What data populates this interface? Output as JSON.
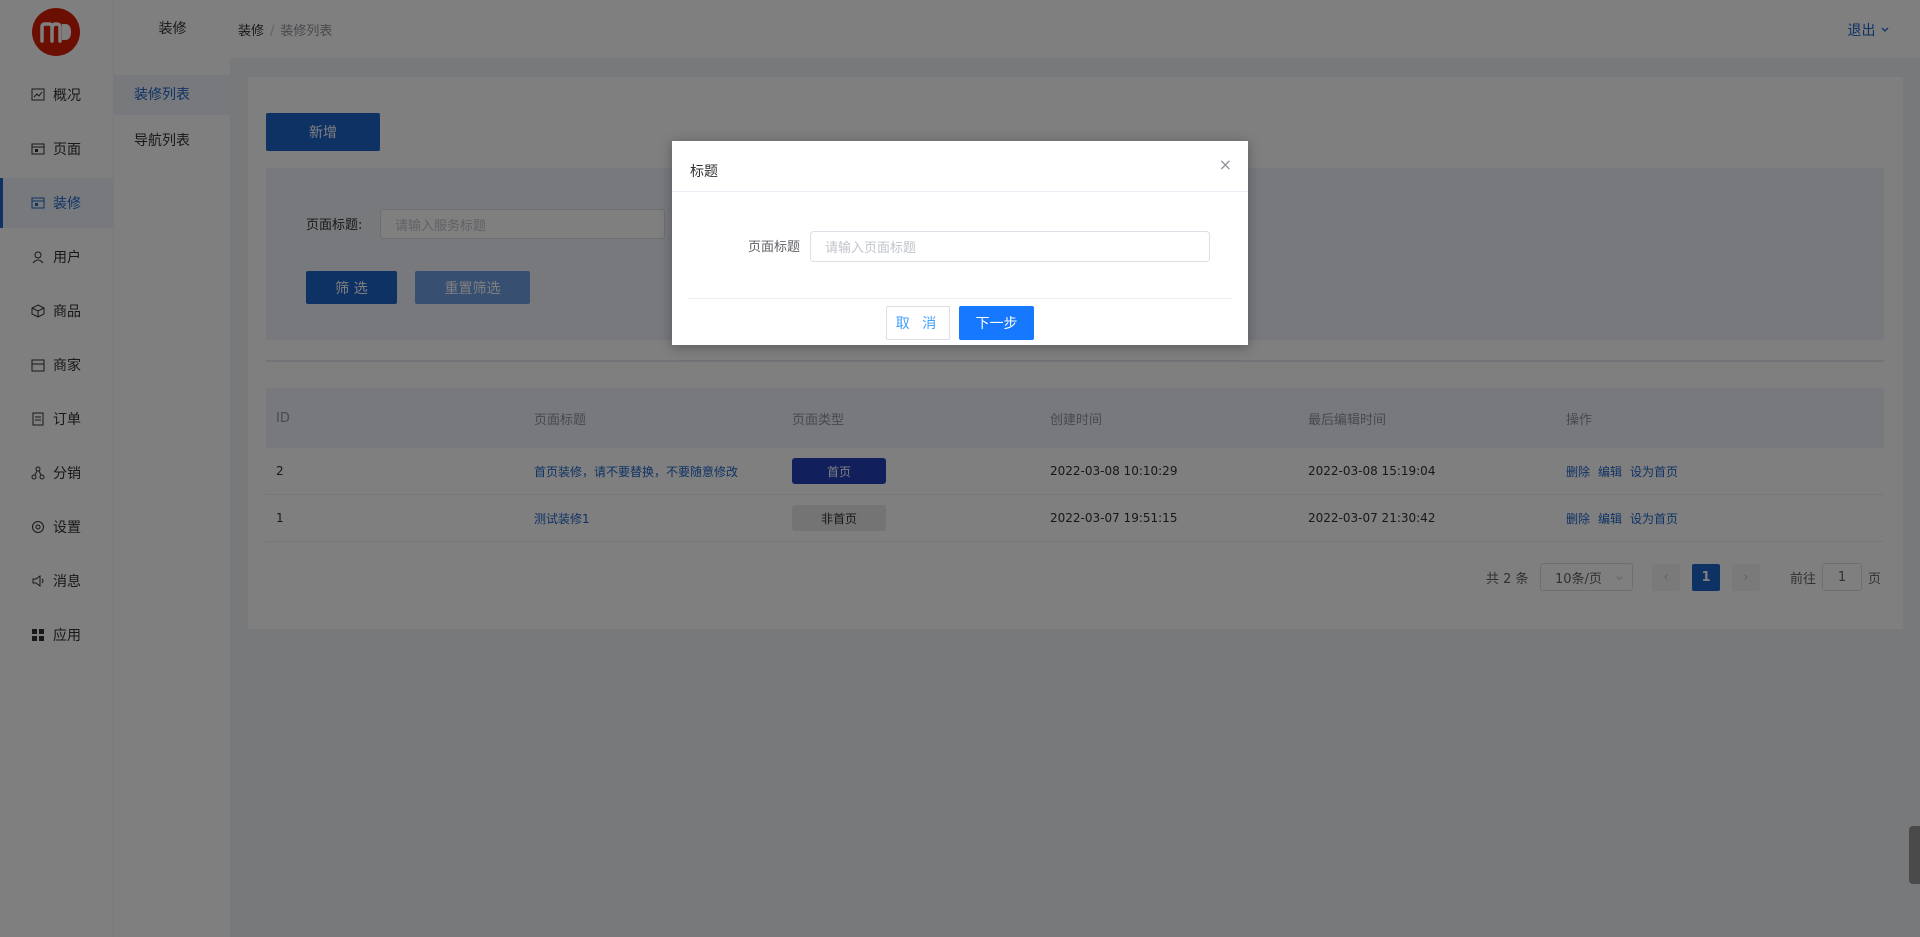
{
  "logo_text": "m",
  "nav": {
    "items": [
      {
        "label": "概况",
        "icon": "chart-icon"
      },
      {
        "label": "页面",
        "icon": "page-icon"
      },
      {
        "label": "装修",
        "icon": "decor-icon",
        "active": true
      },
      {
        "label": "用户",
        "icon": "user-icon"
      },
      {
        "label": "商品",
        "icon": "box-icon"
      },
      {
        "label": "商家",
        "icon": "store-icon"
      },
      {
        "label": "订单",
        "icon": "order-icon"
      },
      {
        "label": "分销",
        "icon": "share-icon"
      },
      {
        "label": "设置",
        "icon": "gear-icon"
      },
      {
        "label": "消息",
        "icon": "speaker-icon"
      },
      {
        "label": "应用",
        "icon": "grid-icon"
      }
    ]
  },
  "subnav": {
    "title": "装修",
    "items": [
      {
        "label": "装修列表",
        "active": true
      },
      {
        "label": "导航列表"
      }
    ]
  },
  "header": {
    "breadcrumb": [
      "装修",
      "装修列表"
    ],
    "separator": "/",
    "logout": "退出"
  },
  "toolbar": {
    "add_label": "新增"
  },
  "filter": {
    "label": "页面标题:",
    "placeholder": "请输入服务标题",
    "filter_button": "筛 选",
    "reset_button": "重置筛选"
  },
  "table": {
    "headers": [
      "ID",
      "页面标题",
      "页面类型",
      "创建时间",
      "最后编辑时间",
      "操作"
    ],
    "rows": [
      {
        "id": "2",
        "title": "首页装修，请不要替换，不要随意修改",
        "type": "首页",
        "created": "2022-03-08 10:10:29",
        "edited": "2022-03-08 15:19:04"
      },
      {
        "id": "1",
        "title": "测试装修1",
        "type": "非首页",
        "created": "2022-03-07 19:51:15",
        "edited": "2022-03-07 21:30:42"
      }
    ],
    "actions": [
      "删除",
      "编辑",
      "设为首页"
    ]
  },
  "pagination": {
    "total": "共 2 条",
    "page_size": "10条/页",
    "prev": "‹",
    "current": "1",
    "next": "›",
    "goto_label": "前往",
    "goto_value": "1",
    "page_unit": "页"
  },
  "dialog": {
    "title": "标题",
    "close": "×",
    "label": "页面标题",
    "placeholder": "请输入页面标题",
    "cancel": "取 消",
    "next": "下一步"
  },
  "colors": {
    "primary": "#1e64c8",
    "dialog_primary": "#1677ff",
    "logo": "#d81e06"
  }
}
